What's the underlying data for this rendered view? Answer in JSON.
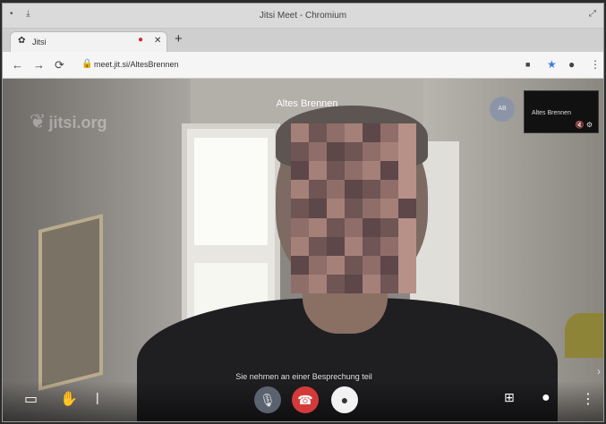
{
  "window": {
    "title": "Jitsi Meet - Chromium",
    "left_controls": "• ⤓",
    "right_controls": "⤢"
  },
  "tab": {
    "label": "Jitsi",
    "rec_icon": "●",
    "close": "✕",
    "newtab": "+"
  },
  "browser": {
    "url": "meet.jit.si/AltesBrennen",
    "back": "←",
    "forward": "→",
    "reload": "⟳"
  },
  "meeting": {
    "watermark": "jitsi.org",
    "participant_name": "Altes Brennen",
    "avatar_initials": "AB",
    "local_video_name": "Altes Brennen",
    "local_video_icons": "🔇 ⚙",
    "subtitle": "Sie nehmen an einer Besprechung teil"
  },
  "icons": {
    "chat": "chat-icon",
    "raise_hand": "raise-hand-icon",
    "mic": "mic-muted-icon",
    "hangup": "hangup-icon",
    "camera": "camera-icon",
    "tile_view": "tile-view-icon",
    "record": "record-icon",
    "more": "more-icon"
  },
  "colors": {
    "hangup": "#d33b3b",
    "mic": "#5a6270",
    "camera": "#f2f2f2",
    "rec": "#d32f2f"
  }
}
